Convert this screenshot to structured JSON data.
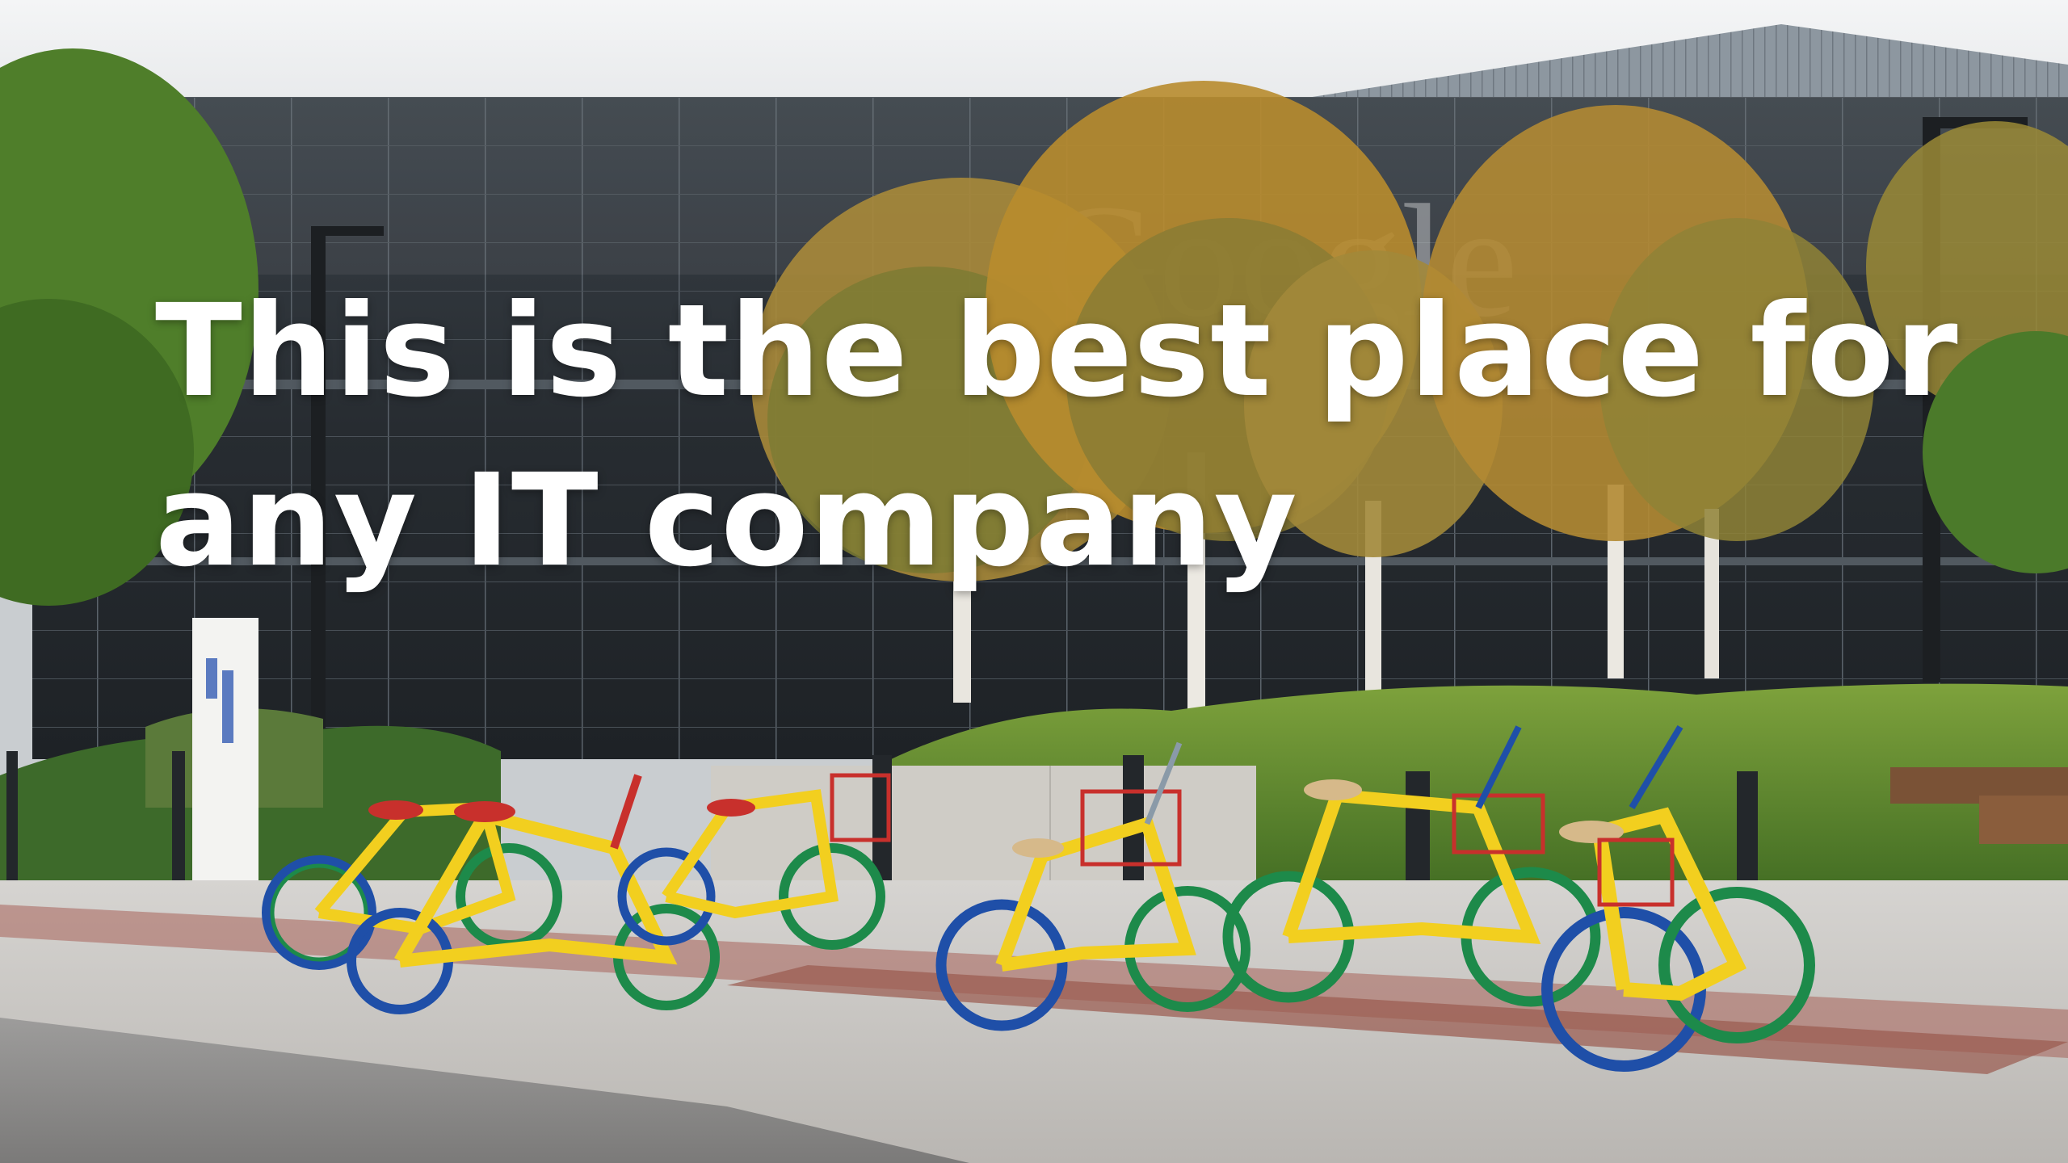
{
  "slide": {
    "headline_line1": "This is the best place for",
    "headline_line2": "any IT company"
  },
  "photo": {
    "subject": "bicycles-in-front-of-office-building",
    "building_sign": "Google",
    "colors": {
      "sky": "#eef0f2",
      "glass": "#2c3238",
      "foliage": "#4d7a28",
      "autumn_leaves": "#b58a2e",
      "pavement": "#c8c6c3",
      "brick_strip": "#9a5a4e",
      "bike_frame": "#f2cf1f",
      "wheel_green": "#1d8a4a",
      "wheel_blue": "#1f4fa8",
      "fender_red": "#d0342c"
    }
  }
}
